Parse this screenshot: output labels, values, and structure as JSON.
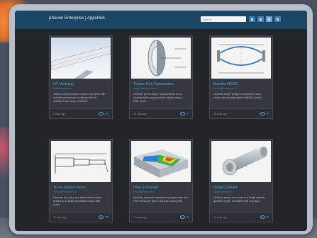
{
  "header": {
    "brand": "pSeven Enterprise | AppsHub",
    "search_placeholder": "Search"
  },
  "colors": {
    "navbar": "#1a4565",
    "accent": "#4aa3df",
    "card": "#35393f",
    "screen": "#22262b"
  },
  "cards": [
    {
      "title": "LIF Modeling",
      "subtitle": "lif@enterprise.ru",
      "description": "Train an approximation model of an airfoil with variable parameters to estimate the lift coefficient and drag coefficient.",
      "date": "2 days ago",
      "count": "123",
      "icon": "airplane-wing-photo"
    },
    {
      "title": "Turbine Disk Optimization",
      "subtitle": "engine@enterprise.ru",
      "description": "Optimize performance characteristics of the rotating disk in a gas-turbine engine using a finite solver.",
      "date": "28 days ago",
      "count": "67",
      "icon": "turbine-disk-drawing"
    },
    {
      "title": "Bistable MEMS",
      "subtitle": "mems@enterprise.ru",
      "description": "Optimize shape design of a bistable micro-electro-mechanical system (MEMS) switch.",
      "date": "28 days ago",
      "count": "45",
      "icon": "mems-diagram"
    },
    {
      "title": "Three-Section Beam",
      "subtitle": "beam@enterprise.ru",
      "description": "Minimize the mass of a three-section beam subject to a rigidity constraint using a filter solver.",
      "date": "12 days ago",
      "count": "145",
      "icon": "beam-diagram"
    },
    {
      "title": "Heat Exchanger",
      "subtitle": "heat@enterprise.ru",
      "description": "Optimize hydraulic resistance and geometry of a heat exchanger with a required cooling rate.",
      "date": "11 days ago",
      "count": "33",
      "icon": "heat-exchanger-render"
    },
    {
      "title": "Single Cylinder",
      "subtitle": "cyl@enterprise.ru",
      "description": "Optimize torque and mass of a single-cylinder gasoline engine simulated with extension.",
      "date": "10 days ago",
      "count": "68",
      "icon": "cylinder-render"
    }
  ]
}
